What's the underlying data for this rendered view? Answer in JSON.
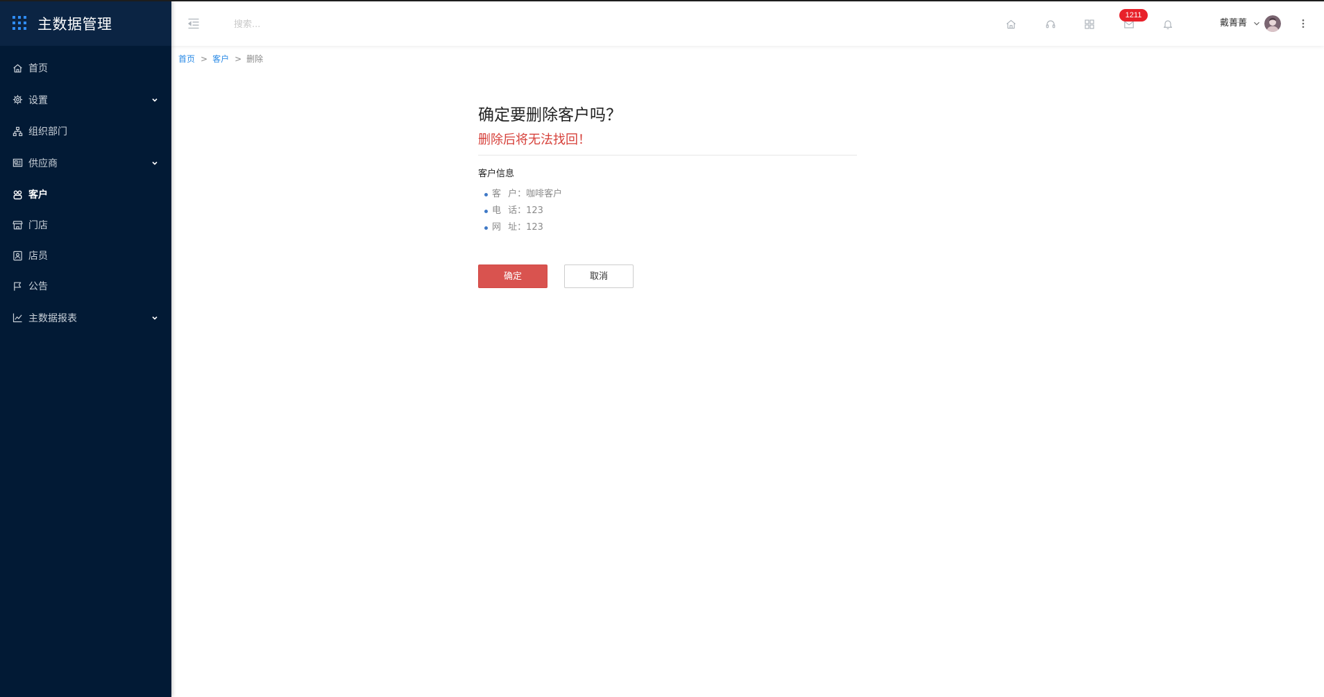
{
  "app": {
    "title": "主数据管理",
    "accent_color": "#2f8cf4",
    "sidebar_bg": "#021a35"
  },
  "sidebar": {
    "items": [
      {
        "label": "首页",
        "icon": "home-icon",
        "expandable": false,
        "active": false
      },
      {
        "label": "设置",
        "icon": "gear-icon",
        "expandable": true,
        "active": false
      },
      {
        "label": "组织部门",
        "icon": "org-chart-icon",
        "expandable": false,
        "active": false
      },
      {
        "label": "供应商",
        "icon": "vendor-icon",
        "expandable": true,
        "active": false
      },
      {
        "label": "客户",
        "icon": "customers-icon",
        "expandable": false,
        "active": true
      },
      {
        "label": "门店",
        "icon": "store-icon",
        "expandable": false,
        "active": false
      },
      {
        "label": "店员",
        "icon": "staff-icon",
        "expandable": false,
        "active": false
      },
      {
        "label": "公告",
        "icon": "announcement-icon",
        "expandable": false,
        "active": false
      },
      {
        "label": "主数据报表",
        "icon": "line-chart-icon",
        "expandable": true,
        "active": false
      }
    ]
  },
  "header": {
    "search_placeholder": "搜索...",
    "icons": [
      "menu-toggle-icon",
      "home-icon",
      "headset-icon",
      "apps-icon",
      "message-icon",
      "bell-icon",
      "more-icon"
    ],
    "message_badge": "1211",
    "badge_color": "#e8212a",
    "username": "戴菁菁"
  },
  "breadcrumb": {
    "items": [
      "首页",
      "客户",
      "删除"
    ],
    "separator": ">"
  },
  "confirm": {
    "title": "确定要删除客户吗？",
    "warning": "删除后将无法找回！",
    "warning_color": "#d6403a",
    "section_title": "客户信息",
    "info": [
      {
        "label": "客 户：",
        "value": "咖啡客户"
      },
      {
        "label": "电 话：",
        "value": "123"
      },
      {
        "label": "网 址：",
        "value": "123"
      }
    ],
    "confirm_label": "确定",
    "cancel_label": "取消",
    "confirm_color": "#d9534f"
  }
}
